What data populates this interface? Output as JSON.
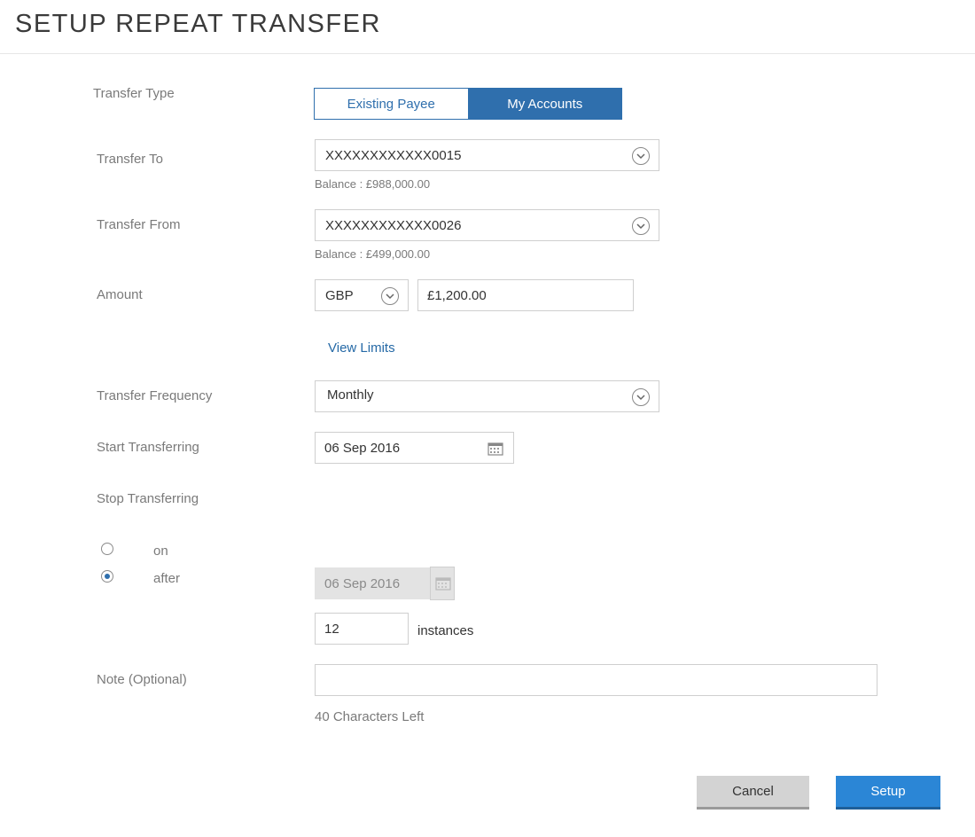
{
  "header": {
    "title": "SETUP REPEAT TRANSFER"
  },
  "transfer_type": {
    "label": "Transfer Type",
    "options": [
      "Existing Payee",
      "My Accounts"
    ],
    "selected": "My Accounts"
  },
  "transfer_to": {
    "label": "Transfer To",
    "value": "XXXXXXXXXXXX0015",
    "balance": "Balance : £988,000.00"
  },
  "transfer_from": {
    "label": "Transfer From",
    "value": "XXXXXXXXXXXX0026",
    "balance": "Balance : £499,000.00"
  },
  "amount": {
    "label": "Amount",
    "currency": "GBP",
    "value": "£1,200.00",
    "view_limits": "View Limits"
  },
  "frequency": {
    "label": "Transfer Frequency",
    "value": "Monthly"
  },
  "start": {
    "label": "Start Transferring",
    "date": "06 Sep 2016"
  },
  "stop": {
    "label": "Stop Transferring",
    "option_on": "on",
    "option_after": "after",
    "selected": "after",
    "date": "06 Sep 2016",
    "instances_value": "12",
    "instances_label": "instances"
  },
  "note": {
    "label": "Note (Optional)",
    "value": "",
    "chars_left": "40 Characters Left"
  },
  "buttons": {
    "cancel": "Cancel",
    "setup": "Setup"
  },
  "colors": {
    "primary": "#2f6fad",
    "setup_button": "#2b86d6",
    "cancel_button": "#d3d3d3"
  }
}
